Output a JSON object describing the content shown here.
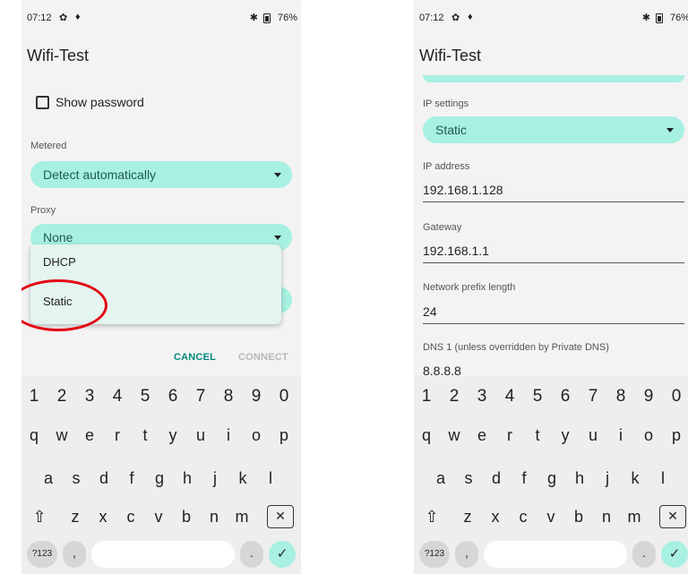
{
  "status": {
    "time": "07:12",
    "gear": "✿",
    "dot": "♦",
    "bt": "✱",
    "battery": "76%",
    "battery_right": "76%"
  },
  "app": {
    "title": "Wifi-Test"
  },
  "left": {
    "show_password": "Show password",
    "metered_label": "Metered",
    "metered_value": "Detect automatically",
    "proxy_label": "Proxy",
    "proxy_value": "None",
    "ip_options": [
      "DHCP",
      "Static"
    ],
    "cancel": "CANCEL",
    "connect": "CONNECT"
  },
  "right": {
    "ip_settings_label": "IP settings",
    "ip_settings_value": "Static",
    "ip_address_label": "IP address",
    "ip_address_value": "192.168.1.128",
    "gateway_label": "Gateway",
    "gateway_value": "192.168.1.1",
    "prefix_label": "Network prefix length",
    "prefix_value": "24",
    "dns1_label": "DNS 1 (unless overridden by Private DNS)",
    "dns1_value": "8.8.8.8"
  },
  "keyboard": {
    "numbers": [
      "1",
      "2",
      "3",
      "4",
      "5",
      "6",
      "7",
      "8",
      "9",
      "0"
    ],
    "row1": [
      "q",
      "w",
      "e",
      "r",
      "t",
      "y",
      "u",
      "i",
      "o",
      "p"
    ],
    "row2": [
      "a",
      "s",
      "d",
      "f",
      "g",
      "h",
      "j",
      "k",
      "l"
    ],
    "row3": [
      "z",
      "x",
      "c",
      "v",
      "b",
      "n",
      "m"
    ],
    "shift": "⇧",
    "backspace": "✕",
    "symbols": "?123",
    "comma": ",",
    "period": ".",
    "enter": "✓"
  },
  "colors": {
    "accent": "#a8f0e1",
    "accent_text": "#00897b",
    "annotation": "#e30613"
  }
}
